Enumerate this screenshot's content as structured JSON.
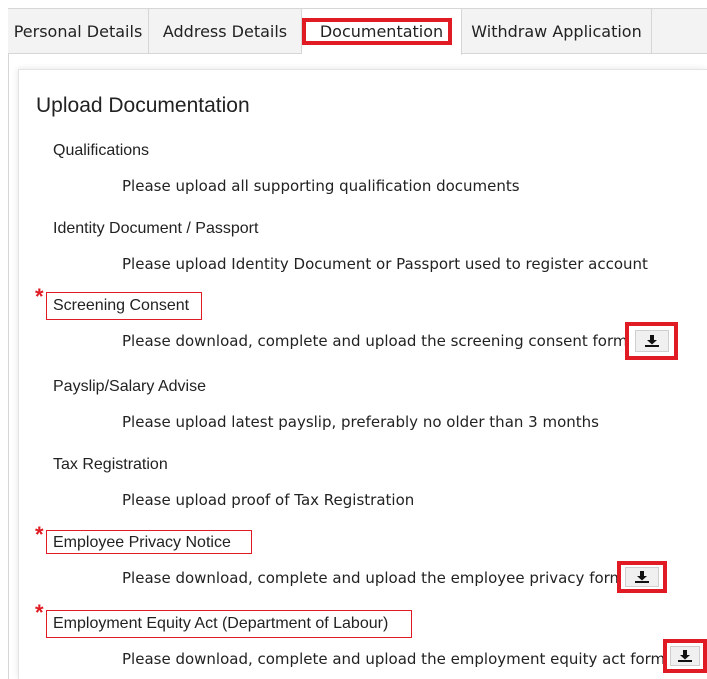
{
  "tabs": [
    {
      "label": "Personal Details"
    },
    {
      "label": "Address Details"
    },
    {
      "label": "Documentation"
    },
    {
      "label": "Withdraw Application"
    }
  ],
  "active_tab": "Documentation",
  "section": {
    "title": "Upload Documentation"
  },
  "documents": [
    {
      "label": "Qualifications",
      "description": "Please upload all supporting qualification documents",
      "required": false
    },
    {
      "label": "Identity Document / Passport",
      "description": "Please upload Identity Document or Passport used to register account",
      "required": false
    },
    {
      "label": "Screening Consent",
      "description": "Please download, complete and upload the screening consent form",
      "required": true,
      "download_icon": "download-icon"
    },
    {
      "label": "Payslip/Salary Advise",
      "description": "Please upload latest payslip, preferably no older than 3 months",
      "required": false
    },
    {
      "label": "Tax Registration",
      "description": "Please upload proof of Tax Registration",
      "required": false
    },
    {
      "label": "Employee Privacy Notice",
      "description": "Please download, complete and upload the employee privacy form",
      "required": true,
      "download_icon": "download-icon"
    },
    {
      "label": "Employment Equity Act (Department of Labour)",
      "description": "Please download, complete and upload the employment equity act form",
      "required": true,
      "download_icon": "download-icon"
    }
  ],
  "required_marker": "*",
  "colors": {
    "highlight": "#e01b24",
    "tab_bg": "#f3f3f3",
    "border": "#d6d6d6"
  }
}
